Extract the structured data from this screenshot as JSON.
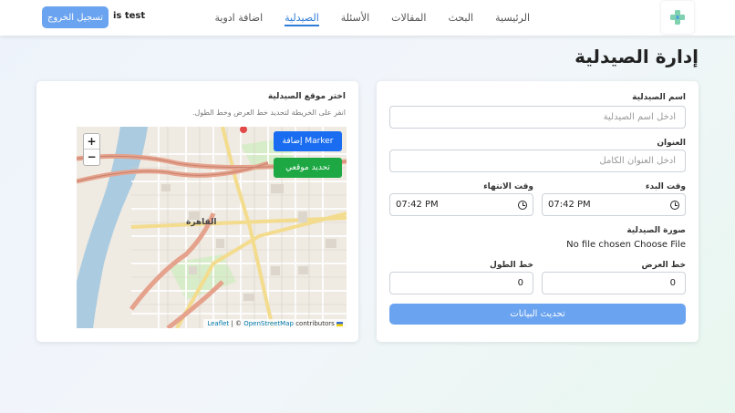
{
  "navbar": {
    "links": [
      "الرئيسية",
      "البحث",
      "المقالات",
      "الأسئلة",
      "الصيدلية",
      "اضافة ادوية"
    ],
    "active_index": 4,
    "user_name": "is test",
    "logout_label": "تسجيل الخروج",
    "logo_icon": "pharmacy-cross-icon"
  },
  "page": {
    "title": "إدارة الصيدلية"
  },
  "form": {
    "name_label": "اسم الصيدلية",
    "name_placeholder": "أدخل اسم الصيدلية",
    "address_label": "العنوان",
    "address_placeholder": "أدخل العنوان الكامل",
    "start_label": "وقت البدء",
    "start_value": "07:42 PM",
    "end_label": "وقت الانتهاء",
    "end_value": "07:42 PM",
    "image_label": "صورة الصيدلية",
    "file_status": "No file chosen Choose File",
    "lat_label": "خط العرض",
    "lat_value": "0",
    "lng_label": "خط الطول",
    "lng_value": "0",
    "submit_label": "تحديث البيانات"
  },
  "map": {
    "title": "اختر موقع الصيدلية",
    "hint": "انقر على الخريطة لتحديد خط العرض وخط الطول.",
    "zoom_in": "+",
    "zoom_out": "−",
    "add_marker_label": "إضافة Marker",
    "locate_label": "تحديد موقعي",
    "attribution_leaflet": "Leaflet",
    "attribution_sep": " | © ",
    "attribution_osm": "OpenStreetMap",
    "attribution_tail": " contributors",
    "place_label_cairo": "القاهرة",
    "colors": {
      "nile": "#a9c9de",
      "motorway": "#e8a38a",
      "primary": "#f6e7a3",
      "park": "#c8e6b5",
      "add_marker_btn": "#1a6df0",
      "locate_btn": "#1ea844"
    }
  },
  "colors": {
    "accent": "#2f7bd8",
    "button": "#6aa3ef"
  }
}
